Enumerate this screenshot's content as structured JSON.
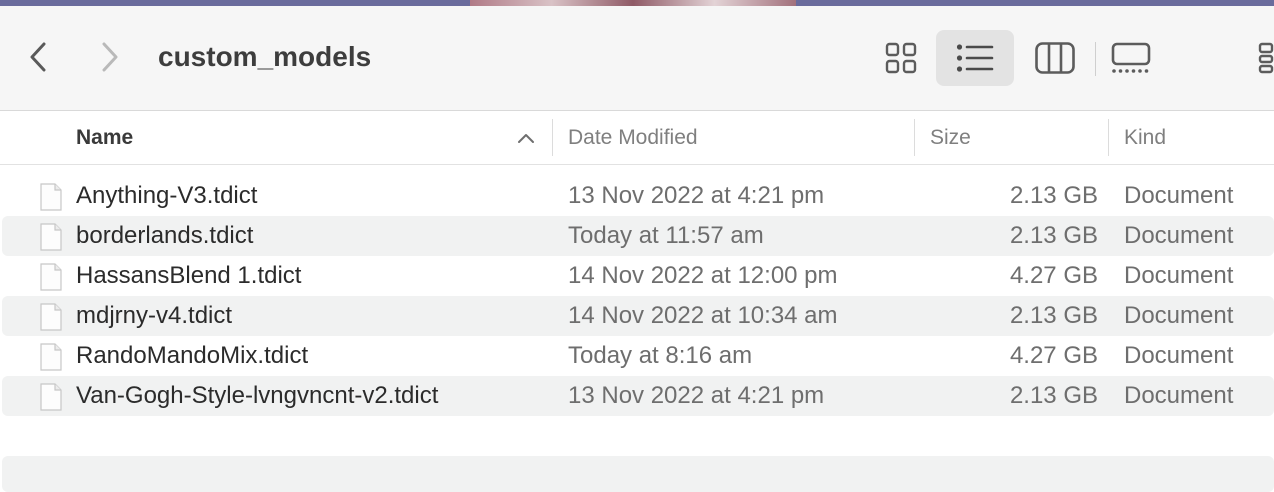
{
  "window": {
    "title": "custom_models"
  },
  "toolbar": {
    "back_icon": "chevron-left-icon",
    "forward_icon": "chevron-right-icon",
    "views": [
      "icons-view-icon",
      "list-view-icon",
      "columns-view-icon",
      "gallery-view-icon"
    ],
    "active_view": "list"
  },
  "columns": {
    "name": "Name",
    "date": "Date Modified",
    "size": "Size",
    "kind": "Kind",
    "sort": "ascending"
  },
  "files": [
    {
      "name": "Anything-V3.tdict",
      "date": "13 Nov 2022 at 4:21 pm",
      "size": "2.13 GB",
      "kind": "Document"
    },
    {
      "name": "borderlands.tdict",
      "date": "Today at 11:57 am",
      "size": "2.13 GB",
      "kind": "Document"
    },
    {
      "name": "HassansBlend 1.tdict",
      "date": "14 Nov 2022 at 12:00 pm",
      "size": "4.27 GB",
      "kind": "Document"
    },
    {
      "name": "mdjrny-v4.tdict",
      "date": "14 Nov 2022 at 10:34 am",
      "size": "2.13 GB",
      "kind": "Document"
    },
    {
      "name": "RandoMandoMix.tdict",
      "date": "Today at 8:16 am",
      "size": "4.27 GB",
      "kind": "Document"
    },
    {
      "name": "Van-Gogh-Style-lvngvncnt-v2.tdict",
      "date": "13 Nov 2022 at 4:21 pm",
      "size": "2.13 GB",
      "kind": "Document"
    }
  ],
  "colors": {
    "toolbar_bg": "#f6f6f6",
    "row_alt": "#f1f2f2",
    "selected_view_bg": "#e3e3e3"
  }
}
